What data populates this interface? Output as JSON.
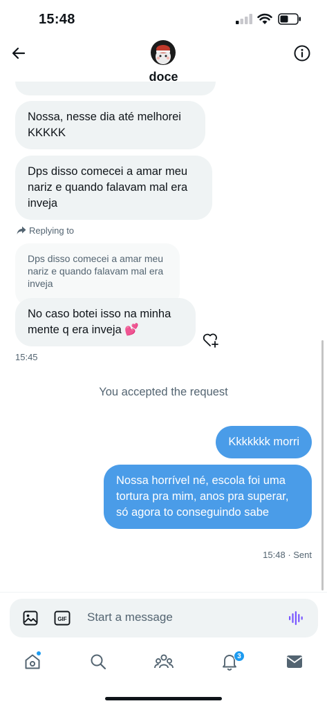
{
  "status_bar": {
    "time": "15:48"
  },
  "header": {
    "contact_name": "doce"
  },
  "messages": {
    "received": [
      {
        "text": "Nossa, nesse dia até melhorei KKKKK"
      },
      {
        "text": "Dps disso comecei a amar meu nariz e quando falavam mal era inveja"
      },
      {
        "text": "No caso botei isso na minha mente q era inveja 💕"
      }
    ],
    "reply_label": "Replying to",
    "quoted_text": "Dps disso comecei a amar meu nariz e quando falavam mal era inveja",
    "received_time": "15:45",
    "system_message": "You accepted the request",
    "sent": [
      {
        "text": "Kkkkkkk morri"
      },
      {
        "text": "Nossa horrível né, escola foi uma tortura pra mim, anos pra superar, só agora to conseguindo sabe"
      }
    ],
    "sent_info": "15:48 · Sent"
  },
  "composer": {
    "placeholder": "Start a message",
    "gif_label": "GIF"
  },
  "bottom_nav": {
    "items": [
      {
        "icon": "home-icon"
      },
      {
        "icon": "search-icon"
      },
      {
        "icon": "communities-icon"
      },
      {
        "icon": "notifications-icon"
      },
      {
        "icon": "messages-icon"
      }
    ],
    "notification_count": "3"
  },
  "colors": {
    "accent": "#1d9bf0",
    "sent_bubble": "#4a9ce8",
    "received_bubble": "#eff3f4",
    "secondary_text": "#536471",
    "voice_icon": "#7856ff"
  }
}
